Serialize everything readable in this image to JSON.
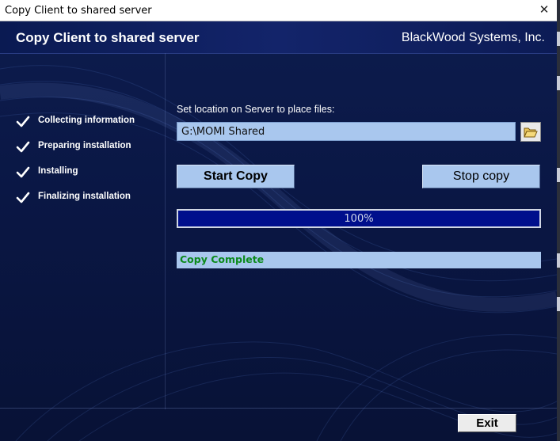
{
  "window": {
    "title": "Copy Client to shared server",
    "close_glyph": "✕"
  },
  "header": {
    "title": "Copy Client to shared server",
    "company": "BlackWood Systems, Inc."
  },
  "steps": [
    {
      "label": "Collecting information",
      "icon": "checkmark-icon"
    },
    {
      "label": "Preparing installation",
      "icon": "checkmark-icon"
    },
    {
      "label": "Installing",
      "icon": "checkmark-icon"
    },
    {
      "label": "Finalizing installation",
      "icon": "checkmark-icon"
    }
  ],
  "location": {
    "label": "Set location on Server to place files:",
    "value": "G:\\MOMI Shared",
    "browse_icon": "folder-open-icon"
  },
  "buttons": {
    "start": "Start Copy",
    "stop": "Stop copy",
    "exit": "Exit"
  },
  "progress": {
    "value": 100,
    "text": "100%"
  },
  "status": {
    "text": "Copy Complete",
    "color": "#0c8a1c"
  },
  "colors": {
    "background": "#0b1640",
    "field": "#a9c7ee",
    "progress_fill": "#000f8c"
  }
}
